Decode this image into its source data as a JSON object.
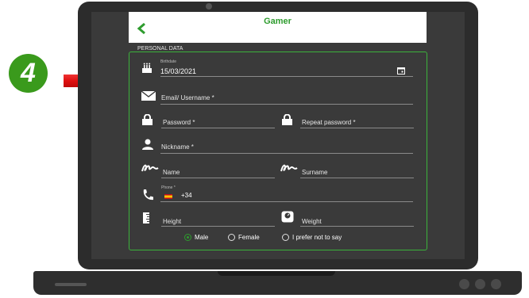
{
  "step_badge": "4",
  "app": {
    "title": "Gamer",
    "back_icon": "chevron-left-icon",
    "accent": "#2e9c2e"
  },
  "section_title": "PERSONAL DATA",
  "fields": {
    "birthdate": {
      "label": "Birthdate",
      "value": "15/03/2021"
    },
    "email": {
      "label": "Email/ Username *"
    },
    "password": {
      "label": "Password *"
    },
    "repeat_password": {
      "label": "Repeat password *"
    },
    "nickname": {
      "label": "Nickname *"
    },
    "name": {
      "label": "Name"
    },
    "surname": {
      "label": "Surname"
    },
    "phone": {
      "label": "Phone *",
      "code": "+34"
    },
    "height": {
      "label": "Height"
    },
    "weight": {
      "label": "Weight"
    }
  },
  "gender": {
    "options": [
      "Male",
      "Female",
      "I prefer not to say"
    ],
    "selected": "Male"
  }
}
